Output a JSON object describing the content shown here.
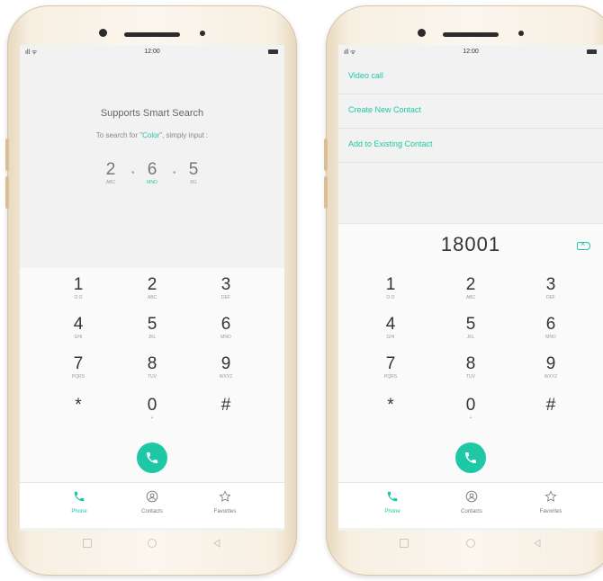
{
  "left_phone": {
    "status": {
      "time": "12:00",
      "signal": "ıll ᯤ"
    },
    "hint": {
      "title": "Supports Smart Search",
      "sub_prefix": "To search for \"",
      "sub_highlight": "Color",
      "sub_suffix": "\", simply input :",
      "digits": [
        {
          "num": "2",
          "letters": "ABC"
        },
        {
          "num": "6",
          "letters": "MNO"
        },
        {
          "num": "5",
          "letters": "JKL"
        }
      ]
    },
    "keys": [
      {
        "num": "1",
        "letters": "O.O"
      },
      {
        "num": "2",
        "letters": "ABC"
      },
      {
        "num": "3",
        "letters": "DEF"
      },
      {
        "num": "4",
        "letters": "GHI"
      },
      {
        "num": "5",
        "letters": "JKL"
      },
      {
        "num": "6",
        "letters": "MNO"
      },
      {
        "num": "7",
        "letters": "PQRS"
      },
      {
        "num": "8",
        "letters": "TUV"
      },
      {
        "num": "9",
        "letters": "WXYZ"
      },
      {
        "num": "*",
        "letters": ""
      },
      {
        "num": "0",
        "letters": "+"
      },
      {
        "num": "#",
        "letters": ""
      }
    ],
    "nav": {
      "phone": "Phone",
      "contacts": "Contacts",
      "favorites": "Favorites"
    }
  },
  "right_phone": {
    "status": {
      "time": "12:00",
      "signal": "ıll ᯤ"
    },
    "menu": [
      "Video call",
      "Create New Contact",
      "Add to Existing Contact"
    ],
    "number": "18001",
    "keys": [
      {
        "num": "1",
        "letters": "O.O"
      },
      {
        "num": "2",
        "letters": "ABC"
      },
      {
        "num": "3",
        "letters": "DEF"
      },
      {
        "num": "4",
        "letters": "GHI"
      },
      {
        "num": "5",
        "letters": "JKL"
      },
      {
        "num": "6",
        "letters": "MNO"
      },
      {
        "num": "7",
        "letters": "PQRS"
      },
      {
        "num": "8",
        "letters": "TUV"
      },
      {
        "num": "9",
        "letters": "WXYZ"
      },
      {
        "num": "*",
        "letters": ""
      },
      {
        "num": "0",
        "letters": "+"
      },
      {
        "num": "#",
        "letters": ""
      }
    ],
    "nav": {
      "phone": "Phone",
      "contacts": "Contacts",
      "favorites": "Favorites"
    }
  },
  "colors": {
    "accent": "#1ec8a5",
    "frame": "#f7efe2",
    "screen": "#f2f2f2"
  }
}
